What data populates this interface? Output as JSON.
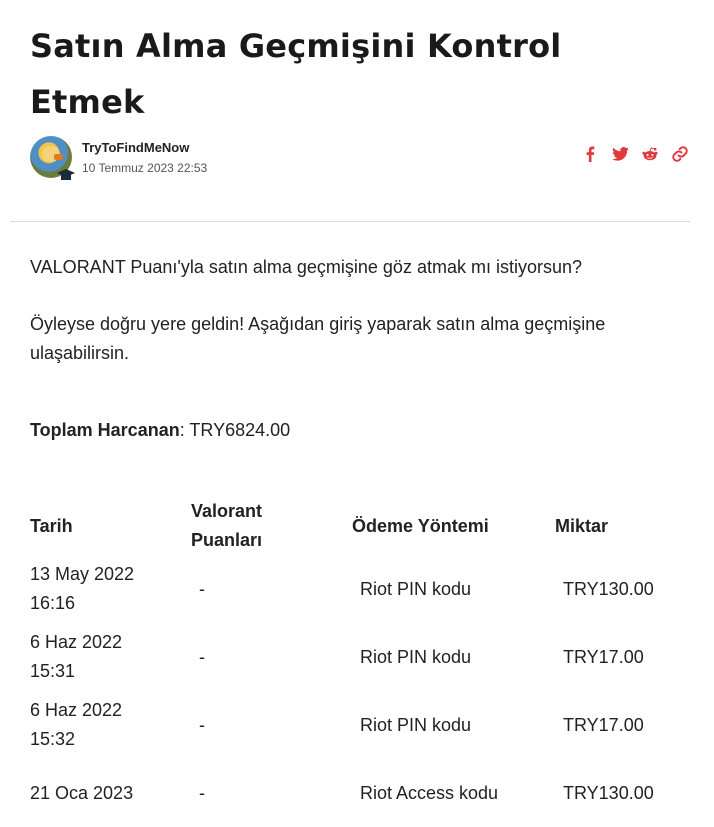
{
  "article": {
    "title": "Satın Alma Geçmişini Kontrol Etmek",
    "author": "TryToFindMeNow",
    "date": "10 Temmuz 2023 22:53"
  },
  "share_icons": [
    "facebook-icon",
    "twitter-icon",
    "reddit-icon",
    "link-icon"
  ],
  "colors": {
    "accent": "#e0393e",
    "divider": "#dadada",
    "text": "#222222"
  },
  "body": {
    "paragraph1": "VALORANT Puanı'yla satın alma geçmişine göz atmak mı istiyorsun?",
    "paragraph2": "Öyleyse doğru yere geldin! Aşağıdan giriş yaparak satın alma geçmişine ulaşabilirsin.",
    "total_label": "Toplam Harcanan",
    "total_value": ": TRY6824.00"
  },
  "table": {
    "headers": [
      "Tarih",
      "Valorant Puanları",
      "Ödeme Yöntemi",
      "Miktar"
    ],
    "rows": [
      {
        "date": "13 May 2022 16:16",
        "points": "-",
        "method": "Riot PIN kodu",
        "amount": "TRY130.00"
      },
      {
        "date": "6 Haz 2022 15:31",
        "points": "-",
        "method": "Riot PIN kodu",
        "amount": "TRY17.00"
      },
      {
        "date": "6 Haz 2022 15:32",
        "points": "-",
        "method": "Riot PIN kodu",
        "amount": "TRY17.00"
      },
      {
        "date": "21 Oca 2023",
        "points": "-",
        "method": "Riot Access kodu",
        "amount": "TRY130.00"
      }
    ]
  }
}
